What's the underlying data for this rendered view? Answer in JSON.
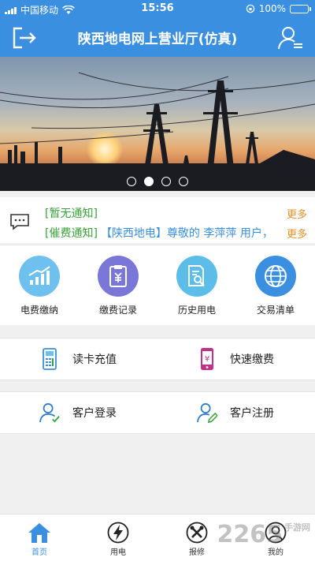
{
  "status_bar": {
    "carrier": "中国移动",
    "time": "15:56",
    "battery": "100%"
  },
  "header": {
    "title": "陕西地电网上营业厅(仿真)"
  },
  "banner": {
    "slide_count": 4,
    "active_index": 1
  },
  "notices": [
    {
      "tag": "[暂无通知]",
      "text": "",
      "more": "更多"
    },
    {
      "tag": "[催费通知]",
      "text": "【陕西地电】尊敬的 李萍萍 用户，",
      "more": "更多"
    }
  ],
  "quick_actions": [
    {
      "label": "电费缴纳",
      "icon": "bar-chart-icon",
      "color": "#6ec1ee"
    },
    {
      "label": "缴费记录",
      "icon": "receipt-icon",
      "color": "#7b77d8"
    },
    {
      "label": "历史用电",
      "icon": "document-search-icon",
      "color": "#5cbde9"
    },
    {
      "label": "交易清单",
      "icon": "globe-icon",
      "color": "#3a8fe0"
    }
  ],
  "services": [
    {
      "label": "读卡充值",
      "icon": "card-reader-icon"
    },
    {
      "label": "快速缴费",
      "icon": "phone-pay-icon"
    }
  ],
  "account": [
    {
      "label": "客户登录",
      "icon": "user-login-icon"
    },
    {
      "label": "客户注册",
      "icon": "user-register-icon"
    }
  ],
  "tabs": [
    {
      "label": "首页",
      "icon": "home-icon",
      "active": true
    },
    {
      "label": "用电",
      "icon": "lightning-icon",
      "active": false
    },
    {
      "label": "报修",
      "icon": "tools-icon",
      "active": false
    },
    {
      "label": "我的",
      "icon": "person-icon",
      "active": false
    }
  ],
  "watermark": {
    "text": "2265",
    "sub": "手游网"
  },
  "colors": {
    "primary": "#3a8fe0",
    "notice_tag": "#3aa03a",
    "more": "#e0922a"
  }
}
